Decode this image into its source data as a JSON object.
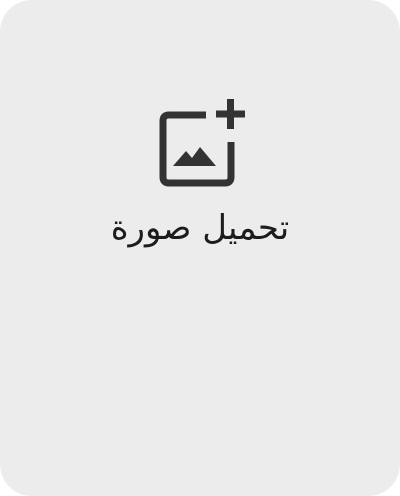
{
  "upload": {
    "label": "تحميل صورة",
    "icon": "add-photo-icon"
  },
  "colors": {
    "card_background": "#ececec",
    "icon": "#333333",
    "text": "#1c1c1c"
  }
}
